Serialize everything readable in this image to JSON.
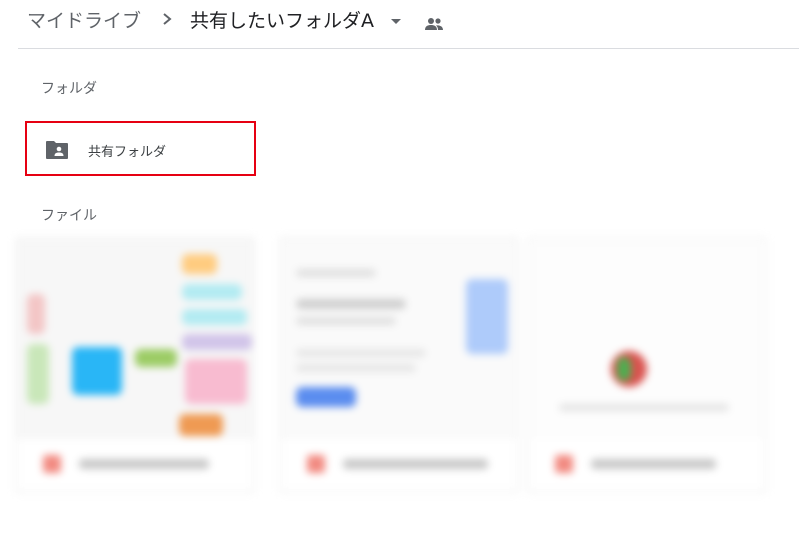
{
  "breadcrumb": {
    "root": "マイドライブ",
    "current": "共有したいフォルダA"
  },
  "icons": {
    "separator": "chevron-right-icon",
    "dropdown": "caret-down-icon",
    "shared": "people-icon",
    "folder": "shared-folder-icon",
    "file": "pdf-file-icon"
  },
  "sections": {
    "folders_label": "フォルダ",
    "files_label": "ファイル"
  },
  "folders": [
    {
      "name": "共有フォルダ",
      "highlighted": true
    }
  ],
  "colors": {
    "highlight_border": "#e60012",
    "file_icon": "#f28b82"
  }
}
